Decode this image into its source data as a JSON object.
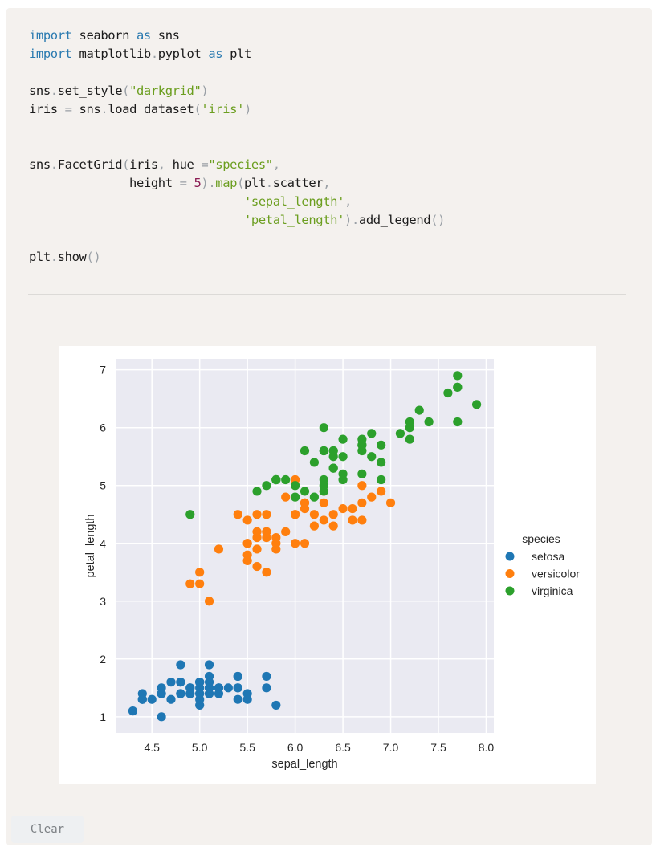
{
  "code_cell": {
    "lines": [
      [
        {
          "t": "import",
          "c": "kw"
        },
        {
          "t": " seaborn "
        },
        {
          "t": "as",
          "c": "kw"
        },
        {
          "t": " sns"
        }
      ],
      [
        {
          "t": "import",
          "c": "kw"
        },
        {
          "t": " matplotlib"
        },
        {
          "t": ".",
          "c": "punc"
        },
        {
          "t": "pyplot "
        },
        {
          "t": "as",
          "c": "kw"
        },
        {
          "t": " plt"
        }
      ],
      [],
      [
        {
          "t": "sns"
        },
        {
          "t": ".",
          "c": "punc"
        },
        {
          "t": "set_style"
        },
        {
          "t": "(",
          "c": "punc"
        },
        {
          "t": "\"darkgrid\"",
          "c": "str"
        },
        {
          "t": ")",
          "c": "punc"
        }
      ],
      [
        {
          "t": "iris "
        },
        {
          "t": "=",
          "c": "punc"
        },
        {
          "t": " sns"
        },
        {
          "t": ".",
          "c": "punc"
        },
        {
          "t": "load_dataset"
        },
        {
          "t": "(",
          "c": "punc"
        },
        {
          "t": "'iris'",
          "c": "str"
        },
        {
          "t": ")",
          "c": "punc"
        }
      ],
      [],
      [],
      [
        {
          "t": "sns"
        },
        {
          "t": ".",
          "c": "punc"
        },
        {
          "t": "FacetGrid"
        },
        {
          "t": "(",
          "c": "punc"
        },
        {
          "t": "iris"
        },
        {
          "t": ",",
          "c": "punc"
        },
        {
          "t": " hue "
        },
        {
          "t": "=",
          "c": "punc"
        },
        {
          "t": "\"species\"",
          "c": "str"
        },
        {
          "t": ",",
          "c": "punc"
        }
      ],
      [
        {
          "t": "              height "
        },
        {
          "t": "=",
          "c": "punc"
        },
        {
          "t": " "
        },
        {
          "t": "5",
          "c": "num"
        },
        {
          "t": ")",
          "c": "punc"
        },
        {
          "t": ".",
          "c": "punc"
        },
        {
          "t": "map",
          "c": "fn"
        },
        {
          "t": "(",
          "c": "punc"
        },
        {
          "t": "plt"
        },
        {
          "t": ".",
          "c": "punc"
        },
        {
          "t": "scatter"
        },
        {
          "t": ",",
          "c": "punc"
        }
      ],
      [
        {
          "t": "                              "
        },
        {
          "t": "'sepal_length'",
          "c": "str"
        },
        {
          "t": ",",
          "c": "punc"
        }
      ],
      [
        {
          "t": "                              "
        },
        {
          "t": "'petal_length'",
          "c": "str"
        },
        {
          "t": ")",
          "c": "punc"
        },
        {
          "t": ".",
          "c": "punc"
        },
        {
          "t": "add_legend"
        },
        {
          "t": "()",
          "c": "punc"
        }
      ],
      [],
      [
        {
          "t": "plt"
        },
        {
          "t": ".",
          "c": "punc"
        },
        {
          "t": "show"
        },
        {
          "t": "()",
          "c": "punc"
        }
      ]
    ]
  },
  "clear_button": {
    "label": "Clear"
  },
  "chart_data": {
    "type": "scatter",
    "title": "",
    "xlabel": "sepal_length",
    "ylabel": "petal_length",
    "xlim": [
      4.12,
      8.08
    ],
    "ylim": [
      0.72,
      7.19
    ],
    "xticks": [
      4.5,
      5.0,
      5.5,
      6.0,
      6.5,
      7.0,
      7.5,
      8.0
    ],
    "xtick_labels": [
      "4.5",
      "5.0",
      "5.5",
      "6.0",
      "6.5",
      "7.0",
      "7.5",
      "8.0"
    ],
    "yticks": [
      1,
      2,
      3,
      4,
      5,
      6,
      7
    ],
    "ytick_labels": [
      "1",
      "2",
      "3",
      "4",
      "5",
      "6",
      "7"
    ],
    "grid": true,
    "style": "darkgrid",
    "legend": {
      "title": "species",
      "placement": "right"
    },
    "series": [
      {
        "name": "setosa",
        "color": "#1f77b4",
        "x": [
          5.1,
          4.9,
          4.7,
          4.6,
          5.0,
          5.4,
          4.6,
          5.0,
          4.4,
          4.9,
          5.4,
          4.8,
          4.8,
          4.3,
          5.8,
          5.7,
          5.4,
          5.1,
          5.7,
          5.1,
          5.4,
          5.1,
          4.6,
          5.1,
          4.8,
          5.0,
          5.0,
          5.2,
          5.2,
          4.7,
          4.8,
          5.4,
          5.2,
          5.5,
          4.9,
          5.0,
          5.5,
          4.9,
          4.4,
          5.1,
          5.0,
          4.5,
          4.4,
          5.0,
          5.1,
          4.8,
          5.1,
          4.6,
          5.3,
          5.0
        ],
        "y": [
          1.4,
          1.4,
          1.3,
          1.5,
          1.4,
          1.7,
          1.4,
          1.5,
          1.4,
          1.5,
          1.5,
          1.6,
          1.4,
          1.1,
          1.2,
          1.5,
          1.3,
          1.4,
          1.7,
          1.5,
          1.7,
          1.5,
          1.0,
          1.7,
          1.9,
          1.6,
          1.6,
          1.5,
          1.4,
          1.6,
          1.6,
          1.5,
          1.5,
          1.4,
          1.5,
          1.2,
          1.3,
          1.4,
          1.3,
          1.5,
          1.3,
          1.3,
          1.3,
          1.6,
          1.9,
          1.4,
          1.6,
          1.4,
          1.5,
          1.4
        ]
      },
      {
        "name": "versicolor",
        "color": "#ff7f0e",
        "x": [
          7.0,
          6.4,
          6.9,
          5.5,
          6.5,
          5.7,
          6.3,
          4.9,
          6.6,
          5.2,
          5.0,
          5.9,
          6.0,
          6.1,
          5.6,
          6.7,
          5.6,
          5.8,
          6.2,
          5.6,
          5.9,
          6.1,
          6.3,
          6.1,
          6.4,
          6.6,
          6.8,
          6.7,
          6.0,
          5.7,
          5.5,
          5.5,
          5.8,
          6.0,
          5.4,
          6.0,
          6.7,
          6.3,
          5.6,
          5.5,
          5.5,
          6.1,
          5.8,
          5.0,
          5.6,
          5.7,
          5.7,
          6.2,
          5.1,
          5.7
        ],
        "y": [
          4.7,
          4.5,
          4.9,
          4.0,
          4.6,
          4.5,
          4.7,
          3.3,
          4.6,
          3.9,
          3.5,
          4.2,
          4.0,
          4.7,
          3.6,
          4.4,
          4.5,
          4.1,
          4.5,
          3.9,
          4.8,
          4.0,
          4.9,
          4.7,
          4.3,
          4.4,
          4.8,
          5.0,
          4.5,
          3.5,
          3.8,
          3.7,
          3.9,
          5.1,
          4.5,
          4.5,
          4.7,
          4.4,
          4.1,
          4.0,
          4.4,
          4.6,
          4.0,
          3.3,
          4.2,
          4.2,
          4.2,
          4.3,
          3.0,
          4.1
        ]
      },
      {
        "name": "virginica",
        "color": "#2ca02c",
        "x": [
          6.3,
          5.8,
          7.1,
          6.3,
          6.5,
          7.6,
          4.9,
          7.3,
          6.7,
          7.2,
          6.5,
          6.4,
          6.8,
          5.7,
          5.8,
          6.4,
          6.5,
          7.7,
          7.7,
          6.0,
          6.9,
          5.6,
          7.7,
          6.3,
          6.7,
          7.2,
          6.2,
          6.1,
          6.4,
          7.2,
          7.4,
          7.9,
          6.4,
          6.3,
          6.1,
          7.7,
          6.3,
          6.4,
          6.0,
          6.9,
          6.7,
          6.9,
          5.8,
          6.8,
          6.7,
          6.7,
          6.3,
          6.5,
          6.2,
          5.9
        ],
        "y": [
          6.0,
          5.1,
          5.9,
          5.6,
          5.8,
          6.6,
          4.5,
          6.3,
          5.8,
          6.1,
          5.1,
          5.3,
          5.5,
          5.0,
          5.1,
          5.3,
          5.5,
          6.7,
          6.9,
          5.0,
          5.7,
          4.9,
          6.7,
          4.9,
          5.7,
          6.0,
          4.8,
          4.9,
          5.6,
          5.8,
          6.1,
          6.4,
          5.6,
          5.1,
          5.6,
          6.1,
          5.6,
          5.5,
          4.8,
          5.4,
          5.6,
          5.1,
          5.1,
          5.9,
          5.7,
          5.2,
          5.0,
          5.2,
          5.4,
          5.1
        ]
      }
    ]
  }
}
